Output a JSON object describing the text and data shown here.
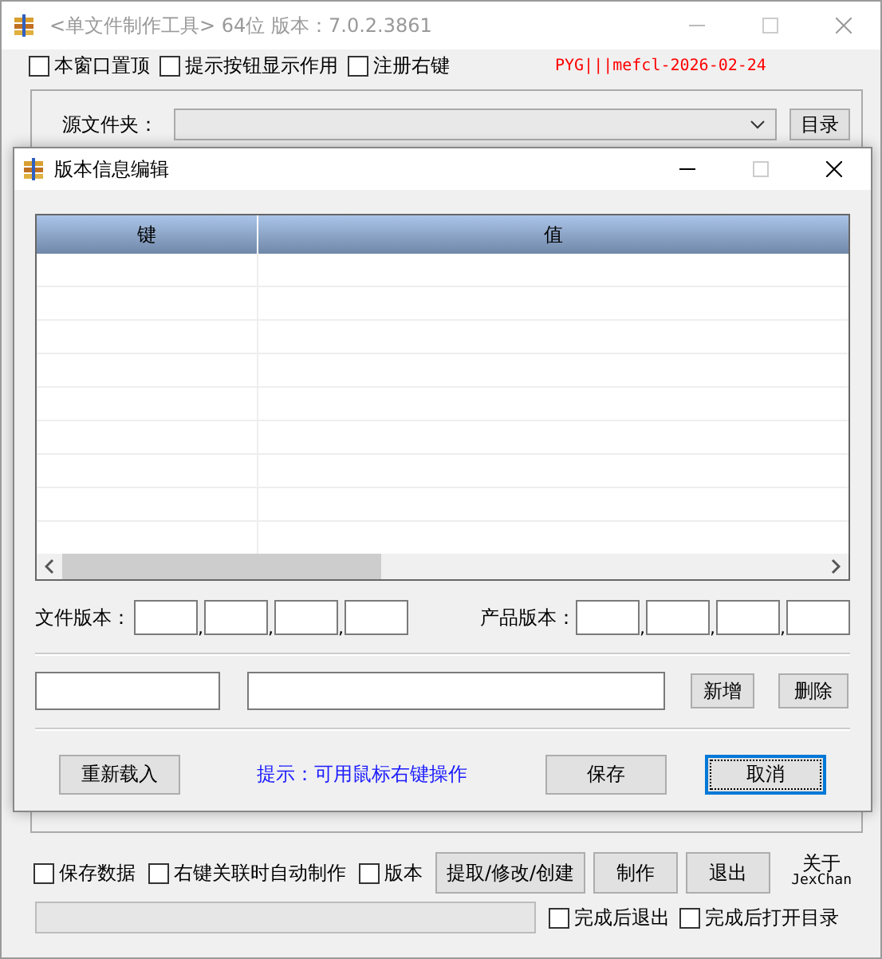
{
  "main_window": {
    "title": "<单文件制作工具> 64位 版本：7.0.2.3861",
    "options": [
      {
        "label": "本窗口置顶",
        "checked": false
      },
      {
        "label": "提示按钮显示作用",
        "checked": false
      },
      {
        "label": "注册右键",
        "checked": false
      }
    ],
    "registration": "PYG|||mefcl-2026-02-24",
    "source_folder_label": "源文件夹：",
    "browse_button": "目录",
    "bottom_options": [
      {
        "label": "保存数据",
        "checked": false
      },
      {
        "label": "右键关联时自动制作",
        "checked": false
      },
      {
        "label": "版本",
        "checked": false
      }
    ],
    "buttons": [
      "提取/修改/创建",
      "制作",
      "退出"
    ],
    "about": [
      "关于",
      "JexChan"
    ],
    "progress": {
      "level": 0
    },
    "finish_options": [
      {
        "label": "完成后退出",
        "checked": false
      },
      {
        "label": "完成后打开目录",
        "checked": false
      }
    ]
  },
  "dialog": {
    "title": "版本信息编辑",
    "table": {
      "columns": [
        "键",
        "值"
      ]
    },
    "file_version": {
      "label": "文件版本：",
      "separators": [
        ",",
        ",",
        ","
      ]
    },
    "product_version": {
      "label": "产品版本：",
      "separators": [
        ",",
        ",",
        ","
      ]
    },
    "add_button": "新增",
    "delete_button": "删除",
    "reload_button": {
      "label": "重新载入",
      "focused": false
    },
    "hint": "提示：可用鼠标右键操作",
    "save_button": {
      "label": "保存",
      "focused": false
    },
    "cancel_button": {
      "label": "取消",
      "focused": true
    }
  }
}
